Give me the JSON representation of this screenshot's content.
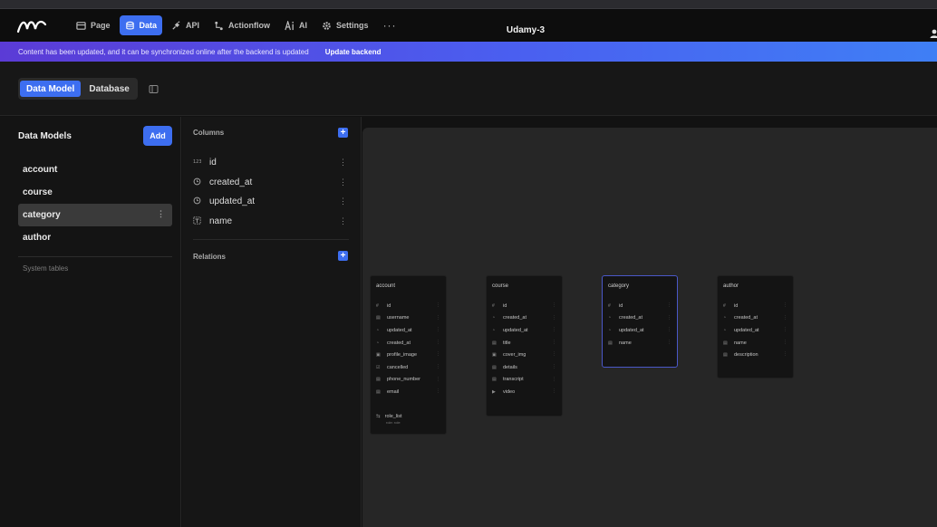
{
  "app": {
    "title": "Udamy-3"
  },
  "nav": {
    "page": "Page",
    "data": "Data",
    "api": "API",
    "actionflow": "Actionflow",
    "ai": "AI",
    "settings": "Settings",
    "more": "···"
  },
  "banner": {
    "message": "Content has been updated, and it can be synchronized online after the backend is updated",
    "action": "Update backend"
  },
  "subbar": {
    "tabs": [
      "Data Model",
      "Database"
    ]
  },
  "left_panel": {
    "title": "Data Models",
    "add_label": "Add",
    "models": [
      "account",
      "course",
      "category",
      "author"
    ],
    "selected": "category",
    "item_menu": "⋮",
    "system_tables": "System tables"
  },
  "columns_panel": {
    "columns_title": "Columns",
    "relations_title": "Relations",
    "plus": "+",
    "row_menu": "⋮",
    "columns": [
      {
        "name": "id",
        "type_icon": "id-icon"
      },
      {
        "name": "created_at",
        "type_icon": "clock-icon"
      },
      {
        "name": "updated_at",
        "type_icon": "clock-icon"
      },
      {
        "name": "name",
        "type_icon": "text-icon"
      }
    ]
  },
  "canvas": {
    "row_menu": "⋮",
    "cards": [
      {
        "title": "account",
        "columns": [
          "id",
          "username",
          "updated_at",
          "created_at",
          "profile_image",
          "cancelled",
          "phone_number",
          "email"
        ],
        "relation": "role_list",
        "relation_sub": "role: role"
      },
      {
        "title": "course",
        "columns": [
          "id",
          "created_at",
          "updated_at",
          "title",
          "cover_img",
          "details",
          "transcript",
          "video"
        ]
      },
      {
        "title": "category",
        "columns": [
          "id",
          "created_at",
          "updated_at",
          "name"
        ],
        "selected": true
      },
      {
        "title": "author",
        "columns": [
          "id",
          "created_at",
          "updated_at",
          "name",
          "description"
        ]
      }
    ]
  },
  "colors": {
    "accent": "#3d6ef0",
    "banner_start": "#5b3bd6",
    "banner_end": "#3f7ff5",
    "selected_border": "#4a58c8"
  }
}
